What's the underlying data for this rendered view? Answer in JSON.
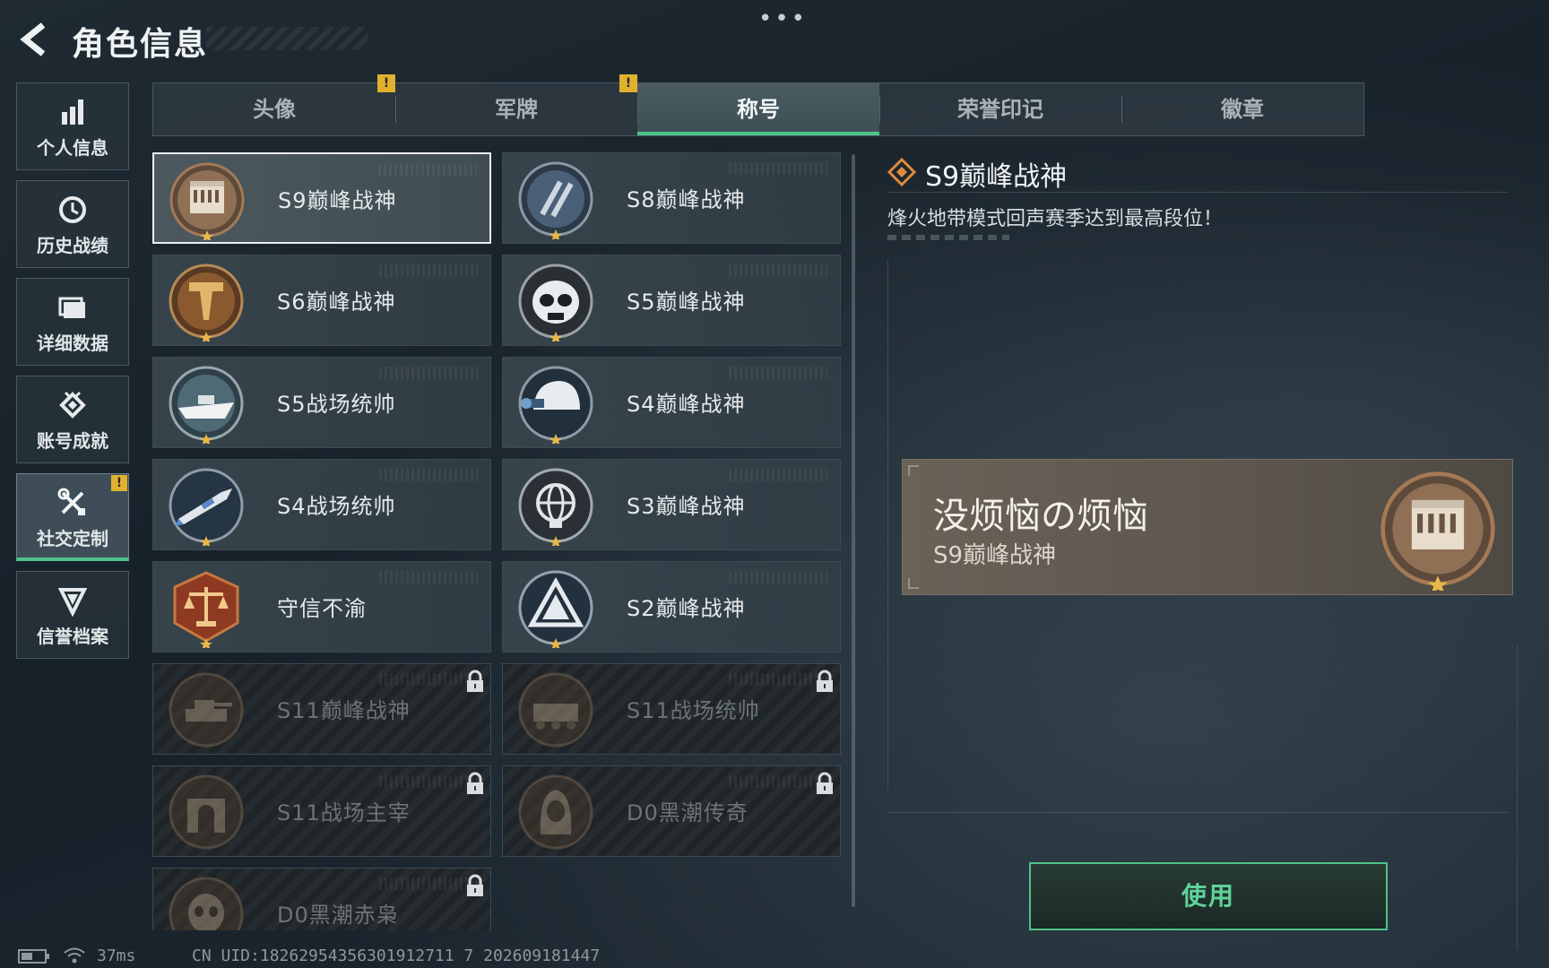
{
  "header": {
    "title": "角色信息"
  },
  "nav": {
    "items": [
      {
        "label": "个人信息",
        "icon": "bar-chart-icon"
      },
      {
        "label": "历史战绩",
        "icon": "clock-icon"
      },
      {
        "label": "详细数据",
        "icon": "folder-icon"
      },
      {
        "label": "账号成就",
        "icon": "achievement-icon"
      },
      {
        "label": "社交定制",
        "icon": "tools-icon",
        "active": true,
        "badge": "!"
      },
      {
        "label": "信誉档案",
        "icon": "shield-v-icon"
      }
    ]
  },
  "tabs": [
    {
      "label": "头像",
      "badge": "!"
    },
    {
      "label": "军牌",
      "badge": "!"
    },
    {
      "label": "称号",
      "active": true
    },
    {
      "label": "荣誉印记"
    },
    {
      "label": "徽章"
    }
  ],
  "titles": [
    {
      "label": "S9巅峰战神",
      "icon": "building-emblem-icon",
      "selected": true
    },
    {
      "label": "S8巅峰战神",
      "icon": "stripes-emblem-icon"
    },
    {
      "label": "S6巅峰战神",
      "icon": "t-emblem-icon"
    },
    {
      "label": "S5巅峰战神",
      "icon": "skull-mask-emblem-icon"
    },
    {
      "label": "S5战场统帅",
      "icon": "boat-emblem-icon"
    },
    {
      "label": "S4巅峰战神",
      "icon": "helmet-nvg-emblem-icon"
    },
    {
      "label": "S4战场统帅",
      "icon": "missile-emblem-icon"
    },
    {
      "label": "S3巅峰战神",
      "icon": "globe-emblem-icon"
    },
    {
      "label": "守信不渝",
      "icon": "scales-emblem-icon"
    },
    {
      "label": "S2巅峰战神",
      "icon": "triangle-emblem-icon"
    },
    {
      "label": "S11巅峰战神",
      "icon": "tank-emblem-icon",
      "locked": true
    },
    {
      "label": "S11战场统帅",
      "icon": "apc-emblem-icon",
      "locked": true
    },
    {
      "label": "S11战场主宰",
      "icon": "arch-emblem-icon",
      "locked": true
    },
    {
      "label": "D0黑潮传奇",
      "icon": "hooded-emblem-icon",
      "locked": true
    },
    {
      "label": "D0黑潮赤枭",
      "icon": "skull-emblem-icon",
      "locked": true
    }
  ],
  "detail": {
    "title": "S9巅峰战神",
    "description": "烽火地带模式回声赛季达到最高段位！",
    "preview_name": "没烦恼の烦恼",
    "preview_subtitle": "S9巅峰战神",
    "use_button": "使用"
  },
  "footer": {
    "ping": "37ms",
    "uid": "CN UID:18262954356301912711 7 202609181447"
  },
  "colors": {
    "accent_green": "#4fc38a",
    "badge_yellow": "#e0b12f",
    "emblem_bronze": "#a47a55",
    "preview_bg": "#5f5950"
  }
}
